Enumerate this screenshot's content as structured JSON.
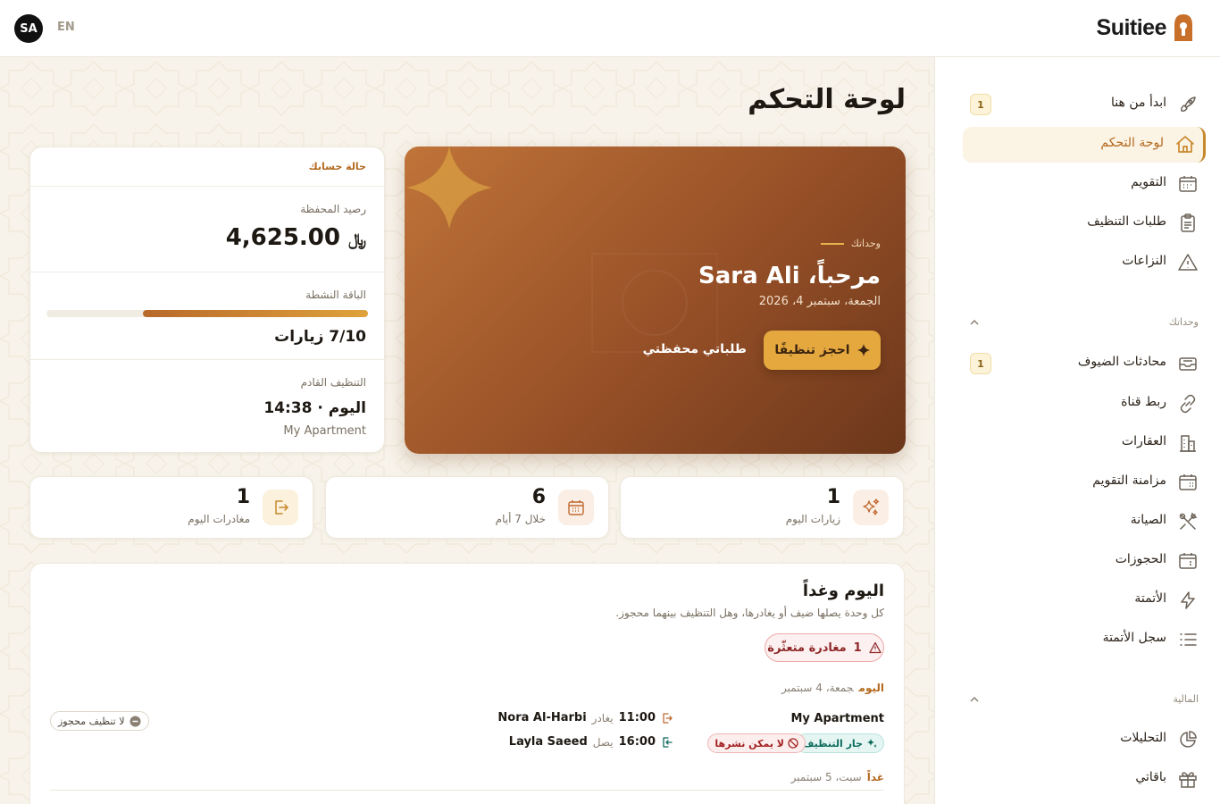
{
  "topbar": {
    "avatar_initials": "SA",
    "language": "EN",
    "brand_name": "Suitiee"
  },
  "sidebar": {
    "items": [
      {
        "label": "ابدأ من هنا",
        "icon": "rocket-icon",
        "badge": "1"
      },
      {
        "label": "لوحة التحكم",
        "icon": "home-icon",
        "active": true
      },
      {
        "label": "التقويم",
        "icon": "calendar-icon"
      },
      {
        "label": "طلبات التنظيف",
        "icon": "clipboard-icon"
      },
      {
        "label": "النزاعات",
        "icon": "warning-icon"
      }
    ],
    "sections": [
      {
        "title": "وحداتك",
        "items": [
          {
            "label": "محادثات الضيوف",
            "icon": "inbox-icon",
            "badge": "1"
          },
          {
            "label": "ربط قناة",
            "icon": "link-icon"
          },
          {
            "label": "العقارات",
            "icon": "building-icon"
          },
          {
            "label": "مزامنة التقويم",
            "icon": "calendar-sync-icon"
          },
          {
            "label": "الصيانة",
            "icon": "tools-icon"
          },
          {
            "label": "الحجوزات",
            "icon": "bookings-icon"
          },
          {
            "label": "الأتمتة",
            "icon": "lightning-icon"
          },
          {
            "label": "سجل الأتمتة",
            "icon": "list-icon"
          }
        ]
      },
      {
        "title": "المالية",
        "items": [
          {
            "label": "التحليلات",
            "icon": "pie-chart-icon"
          },
          {
            "label": "باقاتي",
            "icon": "gift-icon"
          }
        ]
      }
    ]
  },
  "main": {
    "page_title": "لوحة التحكم",
    "account": {
      "header": "حالة حسابك",
      "wallet_label": "رصيد المحفظة",
      "wallet_balance": "4,625.00",
      "currency_symbol": "﷼",
      "plan_label": "الباقة النشطة",
      "plan_visits": "7/10 زيارات",
      "plan_progress": 0.7,
      "next_label": "التنظيف القادم",
      "next_time": "اليوم · 14:38",
      "next_unit": "My Apartment"
    },
    "hero": {
      "kicker": "وحداتك",
      "greeting": "مرحباً، Sara Ali",
      "date": "الجمعة، سبتمبر 4، 2026",
      "book_button": "احجز تنظيفًا",
      "requests_link": "طلباتي",
      "wallet_link": "محفظتي"
    },
    "stats": [
      {
        "value": "1",
        "label": "زيارات اليوم",
        "icon": "sparkles-icon",
        "color": "#fbeee4"
      },
      {
        "value": "6",
        "label": "خلال 7 أيام",
        "icon": "calendar-icon",
        "color": "#fbeee4"
      },
      {
        "value": "1",
        "label": "مغادرات اليوم",
        "icon": "exit-icon",
        "color": "#fbf1dc"
      }
    ],
    "today_tomorrow": {
      "title": "اليوم وغداً",
      "subtitle": "كل وحدة يصلها ضيف أو يغادرها، وهل التنظيف بينهما محجوز.",
      "alert_count": "1",
      "alert_label": "مغادرة متعثّرة",
      "today_key": "اليوم",
      "today_date": "جمعة، 4 سبتمبر",
      "unit": {
        "name": "My Apartment",
        "clean_tag": "جار التنظيف",
        "block_tag": "لا يمكن نشرها",
        "checkout": {
          "time": "11:00",
          "verb": "يغادر",
          "guest": "Nora Al-Harbi"
        },
        "checkin": {
          "time": "16:00",
          "verb": "يصل",
          "guest": "Layla Saeed"
        },
        "no_clean": "لا تنظيف محجوز"
      },
      "tomorrow_key": "غداً",
      "tomorrow_date": "سبت، 5 سبتمبر"
    }
  },
  "colors": {
    "accent": "#c8892e",
    "hero_start": "#c07439",
    "hero_end": "#6c371b",
    "button": "#e4a83f"
  }
}
